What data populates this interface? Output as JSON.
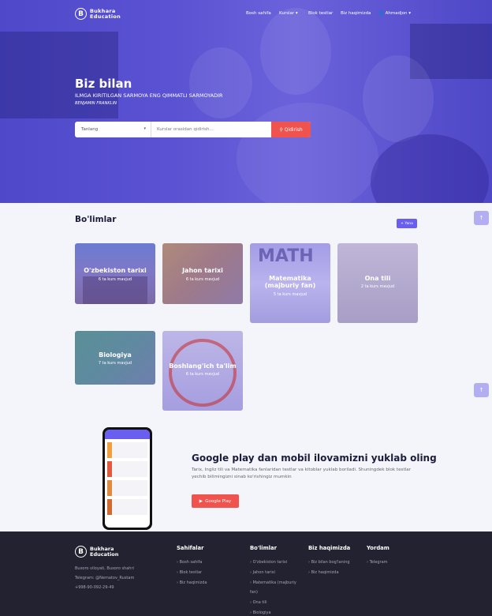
{
  "brand": {
    "letter": "B",
    "line1": "Bukhara",
    "line2": "Education"
  },
  "nav": {
    "home": "Bosh sahifa",
    "courses": "Kurslar",
    "blog": "Blok testlar",
    "about": "Biz haqimizda",
    "user": "Ahmadjon"
  },
  "hero": {
    "title": "Biz bilan",
    "subtitle": "ILMGA KIRITILGAN SARMOYA ENG QIMMATLI SARMOYADIR",
    "author": "BENJAMIN FRANKLIN"
  },
  "search": {
    "select_value": "Tanlang",
    "placeholder": "Kurslar orasidan qidirish...",
    "button": "Qidirish"
  },
  "sections": {
    "title": "Bo'limlar",
    "more_button": "Yana",
    "cards": [
      {
        "title": "O'zbekiston tarixi",
        "count": "6 ta kurs mavjud"
      },
      {
        "title": "Jahon tarixi",
        "count": "6 ta kurs mavjud"
      },
      {
        "title": "Matematika (majburiy fan)",
        "count": "5 ta kurs mavjud"
      },
      {
        "title": "Ona tili",
        "count": "2 ta kurs mavjud"
      },
      {
        "title": "Biologiya",
        "count": "7 ta kurs mavjud"
      },
      {
        "title": "Boshlang'ich ta'lim",
        "count": "6 ta kurs mavjud"
      }
    ]
  },
  "app": {
    "title": "Google play dan mobil ilovamizni yuklab oling",
    "desc": "Tarix, Ingliz tili va Matematika fanlaridan testlar va kitoblar yuklab boriladi. Shuningdek blok testlar yechib bilimingizni sinab ko'rishingiz mumkin",
    "button": "Google Play"
  },
  "footer": {
    "brand_line1": "Bukhara",
    "brand_line2": "Education",
    "address": "Buxoro viloyati, Buxoro shahri",
    "telegram": "Telegram: @Nematov_Rustam",
    "phone": "+998-90-092-29-49",
    "col1": {
      "title": "Sahifalar",
      "items": [
        "Bosh sahifa",
        "Blok testlar",
        "Biz haqimizda"
      ]
    },
    "col2": {
      "title": "Bo'limlar",
      "items": [
        "O'zbekiston tarixi",
        "Jahon tarixi",
        "Matematika (majburiy",
        "fan)",
        "Ona tili",
        "Biologiya"
      ]
    },
    "col3": {
      "title": "Biz haqimizda",
      "items": [
        "Biz bilan bog'laning",
        "Biz haqimizda"
      ]
    },
    "col4": {
      "title": "Yordam",
      "items": [
        "Telegram"
      ]
    }
  },
  "colors": {
    "primary": "#5a52d2",
    "accent": "#f0524d",
    "footer": "#232230"
  }
}
